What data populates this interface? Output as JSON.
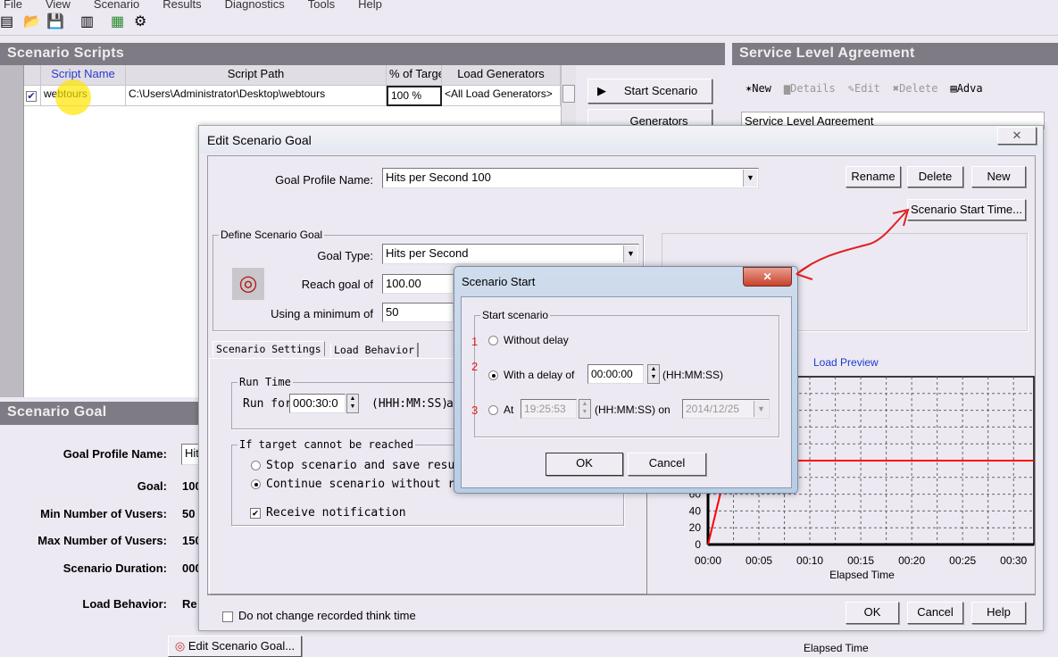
{
  "menu": [
    "File",
    "View",
    "Scenario",
    "Results",
    "Diagnostics",
    "Tools",
    "Help"
  ],
  "scripts": {
    "title": "Scenario Scripts",
    "columns": [
      "Script Name",
      "Script Path",
      "% of Targe",
      "Load Generators"
    ],
    "rows": [
      {
        "checked": true,
        "name": "webtours",
        "path": "C:\\Users\\Administrator\\Desktop\\webtours",
        "percent": "100 %",
        "generators": "<All Load Generators>"
      }
    ]
  },
  "side_buttons": {
    "start": "Start Scenario",
    "generators": "Generators"
  },
  "sla": {
    "title": "Service Level Agreement",
    "toolbar": [
      "New",
      "Details",
      "Edit",
      "Delete",
      "Adva"
    ],
    "list_header": "Service Level Agreement"
  },
  "goal_panel": {
    "title": "Scenario Goal",
    "labels": [
      "Goal Profile Name:",
      "Goal:",
      "Min Number of Vusers:",
      "Max Number of Vusers:",
      "Scenario Duration:",
      "Load Behavior:"
    ],
    "values": [
      "Hit",
      "100",
      "50",
      "150",
      "000",
      "Re"
    ],
    "edit_button": "Edit Scenario Goal..."
  },
  "edit_dialog": {
    "title": "Edit Scenario Goal",
    "profile_label": "Goal Profile Name:",
    "profile_value": "Hits per Second 100",
    "rename": "Rename",
    "delete": "Delete",
    "new": "New",
    "start_time": "Scenario Start Time...",
    "define_group": "Define Scenario Goal",
    "goal_type_label": "Goal Type:",
    "goal_type": "Hits per Second",
    "reach_label": "Reach goal of",
    "reach_value": "100.00",
    "min_label": "Using a minimum of",
    "min_value": "50",
    "tabs": [
      "Scenario Settings",
      "Load Behavior"
    ],
    "run_time_group": "Run Time",
    "run_for_label": "Run for",
    "run_for_value": "000:30:0",
    "run_for_format": "(HHH:MM:SS)",
    "run_for_tail": "a",
    "target_group": "If target cannot be reached",
    "stop_option": "Stop scenario and save results",
    "continue_option": "Continue scenario without reac",
    "selected_target_option": "continue",
    "notify_label": "Receive notification",
    "notify_checked": true,
    "think_time_label": "Do not change recorded think time",
    "think_time_checked": false,
    "ok": "OK",
    "cancel": "Cancel",
    "help": "Help",
    "behind_xlabel": "Elapsed Time"
  },
  "start_dialog": {
    "title": "Scenario Start",
    "group": "Start scenario",
    "options": [
      {
        "marker": "1",
        "label": "Without delay"
      },
      {
        "marker": "2",
        "label": "With a delay of",
        "value": "00:00:00",
        "format": "(HH:MM:SS)"
      },
      {
        "marker": "3",
        "label": "At",
        "value": "19:25:53",
        "format": "(HH:MM:SS) on",
        "date": "2014/12/25"
      }
    ],
    "selected_option": 2,
    "ok": "OK",
    "cancel": "Cancel"
  },
  "chart_data": {
    "type": "line",
    "title": "Load Preview",
    "xlabel": "Elapsed Time",
    "ylabel": "",
    "x_ticks": [
      "00:00",
      "00:05",
      "00:10",
      "00:15",
      "00:20",
      "00:25",
      "00:30"
    ],
    "y_ticks": [
      "0",
      "20",
      "40",
      "60"
    ],
    "xlim_minutes": [
      0,
      32
    ],
    "ylim": [
      0,
      200
    ],
    "grid": true,
    "series": [
      {
        "color": "#ff0000",
        "points": [
          [
            0,
            0
          ],
          [
            2,
            100
          ],
          [
            32,
            100
          ]
        ]
      }
    ]
  },
  "colors": {
    "annotation": "#e02020",
    "header": "#7f7b84",
    "link": "#1a3ccf"
  }
}
